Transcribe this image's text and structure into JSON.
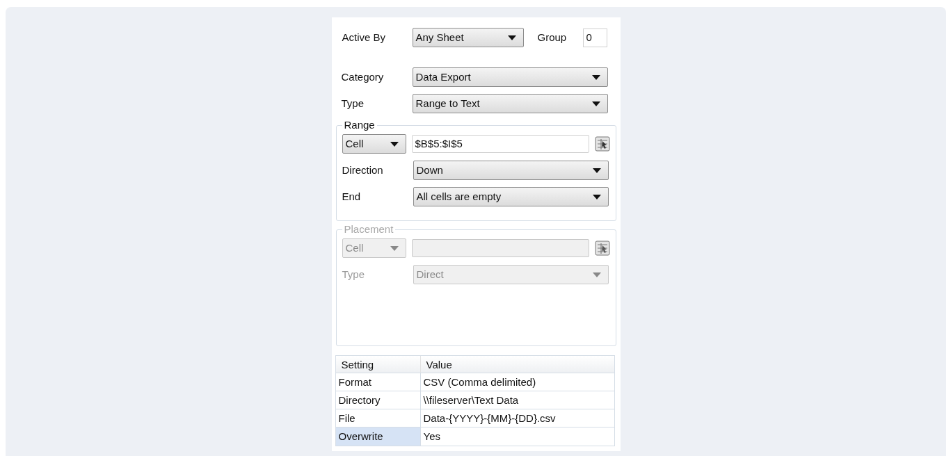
{
  "active_by": {
    "label": "Active By",
    "value": "Any Sheet"
  },
  "group": {
    "label": "Group",
    "value": "0"
  },
  "category": {
    "label": "Category",
    "value": "Data Export"
  },
  "type": {
    "label": "Type",
    "value": "Range to Text"
  },
  "range": {
    "legend": "Range",
    "disabled": false,
    "mode": "Cell",
    "address": "$B$5:$I$5",
    "fields": [
      {
        "label": "Direction",
        "value": "Down"
      },
      {
        "label": "End",
        "value": "All cells are empty"
      }
    ]
  },
  "placement": {
    "legend": "Placement",
    "disabled": true,
    "mode": "Cell",
    "fields": [
      {
        "label": "Type",
        "value": "Direct"
      }
    ]
  },
  "table": {
    "columns": [
      "Setting",
      "Value"
    ],
    "rows": [
      {
        "setting": "Format",
        "value": "CSV (Comma delimited)",
        "selected": false
      },
      {
        "setting": "Directory",
        "value": "\\\\fileserver\\Text Data",
        "selected": false
      },
      {
        "setting": "File",
        "value": "Data-{YYYY}-{MM}-{DD}.csv",
        "selected": false
      },
      {
        "setting": "Overwrite",
        "value": "Yes",
        "selected": true
      }
    ]
  }
}
